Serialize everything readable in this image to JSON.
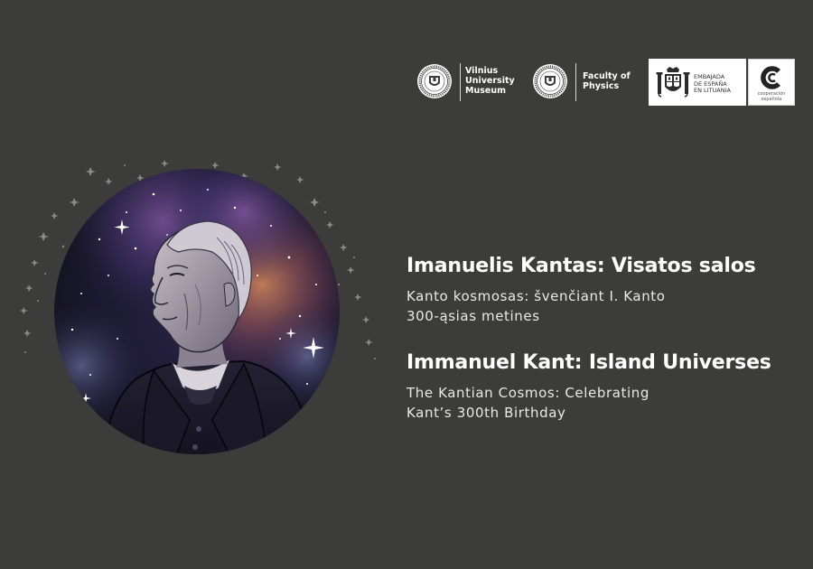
{
  "logos": {
    "vilnius_university_museum": {
      "name_lines": [
        "Vilnius",
        "University",
        "Museum"
      ],
      "icon": "vilnius-university-seal-icon"
    },
    "faculty_of_physics": {
      "name_lines": [
        "Faculty of",
        "Physics"
      ],
      "icon": "vilnius-university-seal-icon"
    },
    "embassy": {
      "name_lines": [
        "EMBAJADA",
        "DE ESPAÑA",
        "EN LITUANIA"
      ],
      "icon": "spanish-coat-of-arms-icon"
    },
    "cooperacion": {
      "name_lines": [
        "cooperación",
        "española"
      ],
      "icon": "cooperacion-espanola-icon"
    }
  },
  "lithuanian": {
    "title": "Imanuelis Kantas: Visatos salos",
    "subtitle_lines": [
      "Kanto kosmosas: švenčiant I. Kanto",
      "300-ąsias metines"
    ]
  },
  "english": {
    "title": "Immanuel Kant: Island Universes",
    "subtitle_lines": [
      "The Kantian Cosmos: Celebrating",
      "Kant’s 300th Birthday"
    ]
  },
  "colors": {
    "background": "#3c3d3b",
    "text": "#ffffff",
    "nebula_purple": "#5a3a7a",
    "nebula_orange": "#c8704a"
  },
  "illustration": {
    "subject": "portrait-of-immanuel-kant-icon",
    "background": "starry-nebula-circle"
  }
}
